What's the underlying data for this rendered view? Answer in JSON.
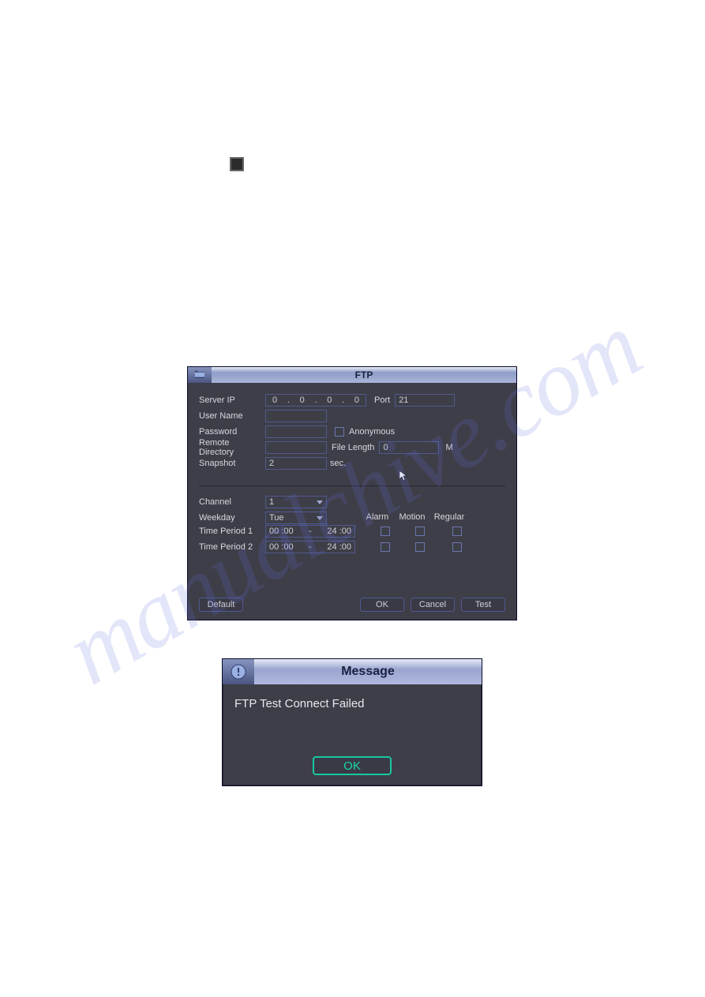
{
  "watermark": "manualchive.com",
  "ftp": {
    "title": "FTP",
    "labels": {
      "server_ip": "Server IP",
      "port": "Port",
      "user_name": "User Name",
      "password": "Password",
      "anonymous": "Anonymous",
      "remote_dir": "Remote Directory",
      "file_length": "File Length",
      "m_unit": "M",
      "snapshot": "Snapshot",
      "sec": "sec.",
      "channel": "Channel",
      "weekday": "Weekday",
      "time_period_1": "Time Period 1",
      "time_period_2": "Time Period 2",
      "alarm": "Alarm",
      "motion": "Motion",
      "regular": "Regular"
    },
    "values": {
      "ip": [
        "0",
        "0",
        "0",
        "0"
      ],
      "port": "21",
      "user_name": "",
      "password": "",
      "anonymous_checked": false,
      "remote_dir": "",
      "file_length": "0",
      "snapshot": "2",
      "channel": "1",
      "weekday": "Tue",
      "tp1_start": "00 :00",
      "tp1_end": "24 :00",
      "tp2_start": "00 :00",
      "tp2_end": "24 :00"
    },
    "buttons": {
      "default": "Default",
      "ok": "OK",
      "cancel": "Cancel",
      "test": "Test"
    }
  },
  "message": {
    "title": "Message",
    "text": "FTP Test Connect Failed",
    "ok": "OK"
  }
}
